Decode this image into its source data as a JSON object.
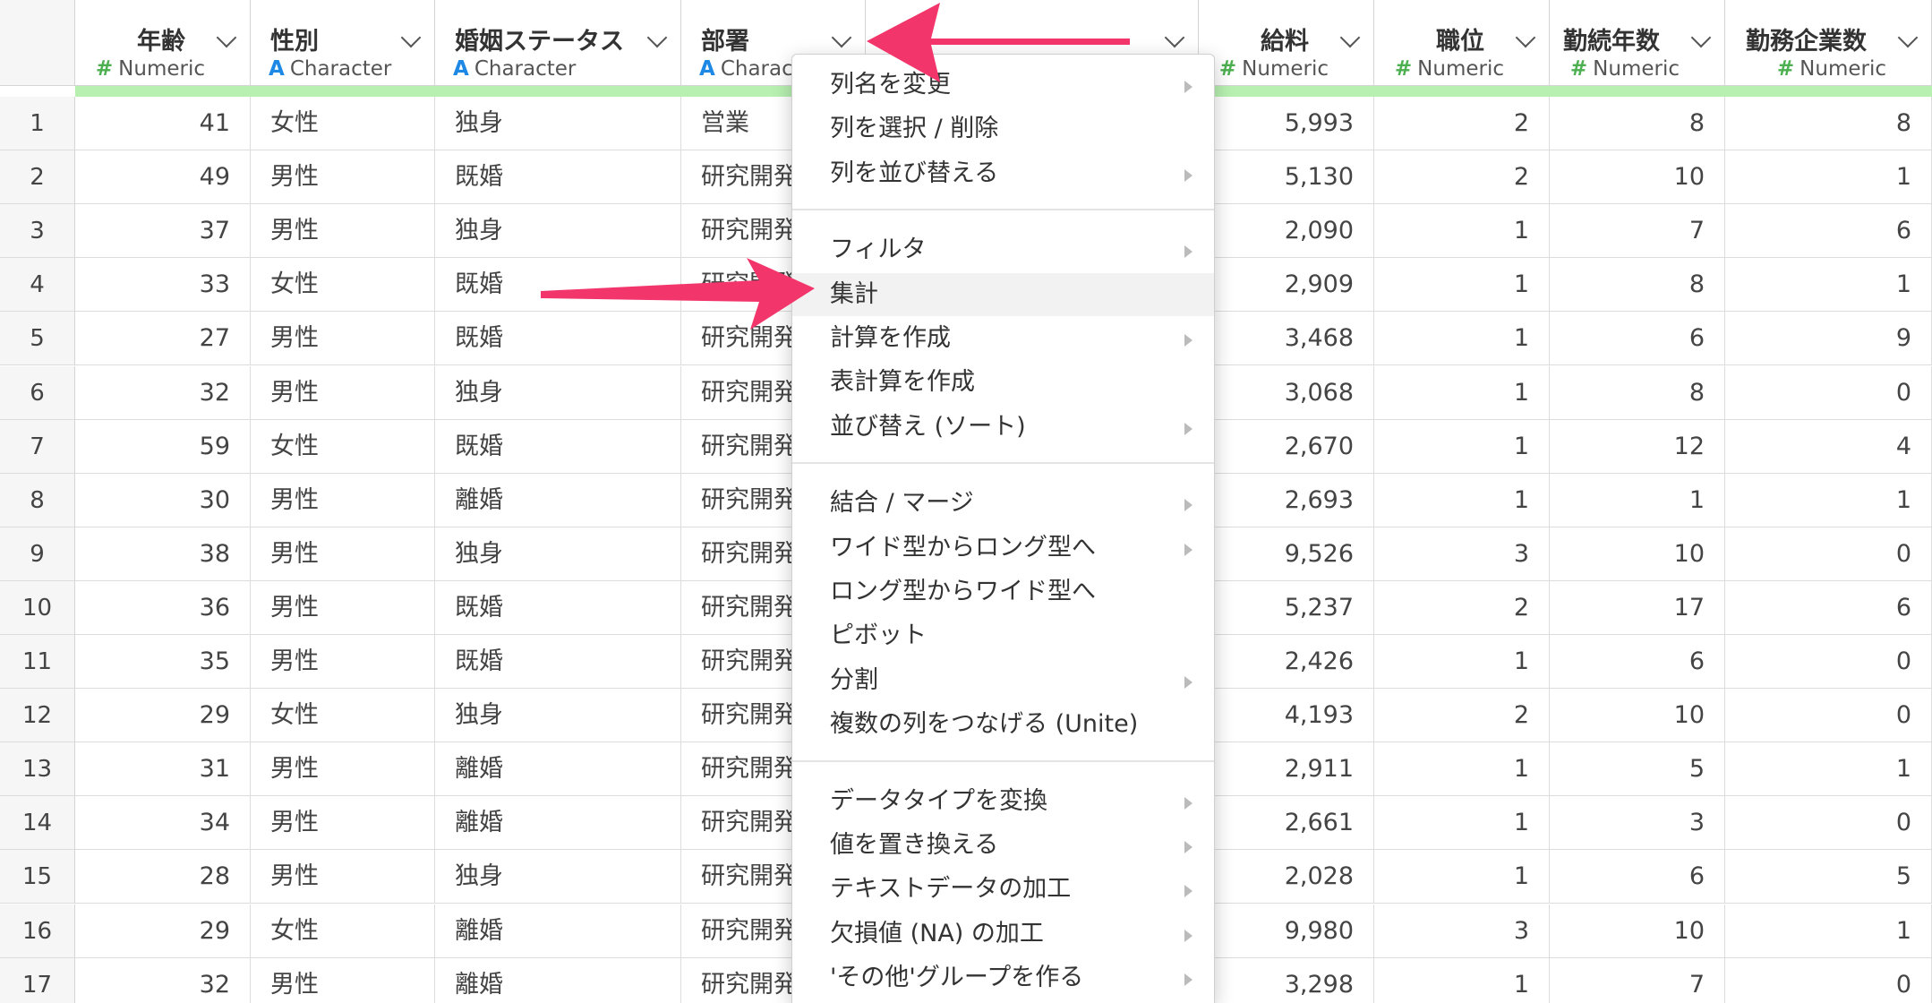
{
  "columns": [
    {
      "key": "rownum",
      "label": "",
      "type": "",
      "align": "c"
    },
    {
      "key": "age",
      "label": "年齢",
      "type": "Numeric",
      "align": "n"
    },
    {
      "key": "gender",
      "label": "性別",
      "type": "Character",
      "align": "c"
    },
    {
      "key": "marital",
      "label": "婚姻ステータス",
      "type": "Character",
      "align": "c"
    },
    {
      "key": "dept",
      "label": "部署",
      "type": "Character",
      "align": "c"
    },
    {
      "key": "hidden",
      "label": "",
      "type": "",
      "align": "c"
    },
    {
      "key": "salary",
      "label": "給料",
      "type": "Numeric",
      "align": "n"
    },
    {
      "key": "position",
      "label": "職位",
      "type": "Numeric",
      "align": "n"
    },
    {
      "key": "tenure",
      "label": "勤続年数",
      "type": "Numeric",
      "align": "n"
    },
    {
      "key": "companies",
      "label": "勤務企業数",
      "type": "Numeric",
      "align": "n"
    }
  ],
  "rows": [
    {
      "n": "1",
      "age": "41",
      "gender": "女性",
      "marital": "独身",
      "dept": "営業",
      "salary": "5,993",
      "position": "2",
      "tenure": "8",
      "companies": "8"
    },
    {
      "n": "2",
      "age": "49",
      "gender": "男性",
      "marital": "既婚",
      "dept": "研究開発",
      "salary": "5,130",
      "position": "2",
      "tenure": "10",
      "companies": "1"
    },
    {
      "n": "3",
      "age": "37",
      "gender": "男性",
      "marital": "独身",
      "dept": "研究開発",
      "salary": "2,090",
      "position": "1",
      "tenure": "7",
      "companies": "6"
    },
    {
      "n": "4",
      "age": "33",
      "gender": "女性",
      "marital": "既婚",
      "dept": "研究開発",
      "salary": "2,909",
      "position": "1",
      "tenure": "8",
      "companies": "1"
    },
    {
      "n": "5",
      "age": "27",
      "gender": "男性",
      "marital": "既婚",
      "dept": "研究開発",
      "salary": "3,468",
      "position": "1",
      "tenure": "6",
      "companies": "9"
    },
    {
      "n": "6",
      "age": "32",
      "gender": "男性",
      "marital": "独身",
      "dept": "研究開発",
      "salary": "3,068",
      "position": "1",
      "tenure": "8",
      "companies": "0"
    },
    {
      "n": "7",
      "age": "59",
      "gender": "女性",
      "marital": "既婚",
      "dept": "研究開発",
      "salary": "2,670",
      "position": "1",
      "tenure": "12",
      "companies": "4"
    },
    {
      "n": "8",
      "age": "30",
      "gender": "男性",
      "marital": "離婚",
      "dept": "研究開発",
      "salary": "2,693",
      "position": "1",
      "tenure": "1",
      "companies": "1"
    },
    {
      "n": "9",
      "age": "38",
      "gender": "男性",
      "marital": "独身",
      "dept": "研究開発",
      "salary": "9,526",
      "position": "3",
      "tenure": "10",
      "companies": "0"
    },
    {
      "n": "10",
      "age": "36",
      "gender": "男性",
      "marital": "既婚",
      "dept": "研究開発",
      "salary": "5,237",
      "position": "2",
      "tenure": "17",
      "companies": "6"
    },
    {
      "n": "11",
      "age": "35",
      "gender": "男性",
      "marital": "既婚",
      "dept": "研究開発",
      "salary": "2,426",
      "position": "1",
      "tenure": "6",
      "companies": "0"
    },
    {
      "n": "12",
      "age": "29",
      "gender": "女性",
      "marital": "独身",
      "dept": "研究開発",
      "salary": "4,193",
      "position": "2",
      "tenure": "10",
      "companies": "0"
    },
    {
      "n": "13",
      "age": "31",
      "gender": "男性",
      "marital": "離婚",
      "dept": "研究開発",
      "salary": "2,911",
      "position": "1",
      "tenure": "5",
      "companies": "1"
    },
    {
      "n": "14",
      "age": "34",
      "gender": "男性",
      "marital": "離婚",
      "dept": "研究開発",
      "salary": "2,661",
      "position": "1",
      "tenure": "3",
      "companies": "0"
    },
    {
      "n": "15",
      "age": "28",
      "gender": "男性",
      "marital": "独身",
      "dept": "研究開発",
      "salary": "2,028",
      "position": "1",
      "tenure": "6",
      "companies": "5"
    },
    {
      "n": "16",
      "age": "29",
      "gender": "女性",
      "marital": "離婚",
      "dept": "研究開発",
      "salary": "9,980",
      "position": "3",
      "tenure": "10",
      "companies": "1"
    },
    {
      "n": "17",
      "age": "32",
      "gender": "男性",
      "marital": "離婚",
      "dept": "研究開発",
      "salary": "3,298",
      "position": "1",
      "tenure": "7",
      "companies": "0"
    }
  ],
  "menu": {
    "groups": [
      [
        {
          "label": "列名を変更",
          "submenu": true
        },
        {
          "label": "列を選択 / 削除",
          "submenu": false
        },
        {
          "label": "列を並び替える",
          "submenu": true
        }
      ],
      [
        {
          "label": "フィルタ",
          "submenu": true
        },
        {
          "label": "集計",
          "submenu": false,
          "highlighted": true
        },
        {
          "label": "計算を作成",
          "submenu": true
        },
        {
          "label": "表計算を作成",
          "submenu": false
        },
        {
          "label": "並び替え (ソート)",
          "submenu": true
        }
      ],
      [
        {
          "label": "結合 / マージ",
          "submenu": true
        },
        {
          "label": "ワイド型からロング型へ",
          "submenu": true
        },
        {
          "label": "ロング型からワイド型へ",
          "submenu": false
        },
        {
          "label": "ピボット",
          "submenu": false
        },
        {
          "label": "分割",
          "submenu": true
        },
        {
          "label": "複数の列をつなげる (Unite)",
          "submenu": false
        }
      ],
      [
        {
          "label": "データタイプを変換",
          "submenu": true
        },
        {
          "label": "値を置き換える",
          "submenu": true
        },
        {
          "label": "テキストデータの加工",
          "submenu": true
        },
        {
          "label": "欠損値 (NA) の加工",
          "submenu": true
        },
        {
          "label": "'その他'グループを作る",
          "submenu": true
        }
      ]
    ]
  },
  "colors": {
    "accent_arrow": "#f2366b",
    "type_numeric": "#4caf50",
    "type_character": "#1e88e5",
    "header_bar": "#b7f0b0"
  }
}
